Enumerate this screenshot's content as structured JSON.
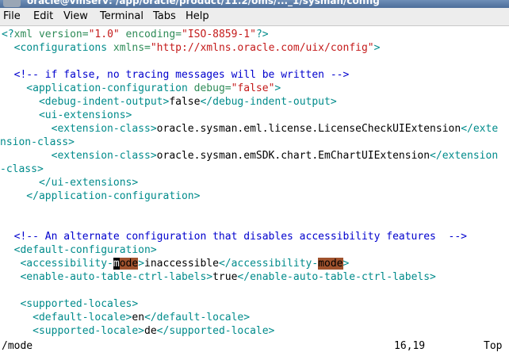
{
  "window": {
    "title": "oracle@vmserv: /app/oracle/product/11.2/oms/..._1/sysman/config"
  },
  "menu": {
    "file": "File",
    "edit": "Edit",
    "view": "View",
    "terminal": "Terminal",
    "tabs": "Tabs",
    "help": "Help"
  },
  "lines": {
    "l1": {
      "p1": "<?",
      "p2": "xml",
      "p3": " version=",
      "p4": "\"1.0\"",
      "p5": " encoding=",
      "p6": "\"ISO-8859-1\"",
      "p7": "?>"
    },
    "l2": {
      "p1": "  <configurations ",
      "p2": "xmlns=",
      "p3": "\"http://xmlns.oracle.com/uix/config\"",
      "p4": ">"
    },
    "l4": {
      "p1": "  <!-- if false, no tracing messages will be written -->"
    },
    "l5": {
      "p1": "    <application-configuration ",
      "p2": "debug=",
      "p3": "\"false\"",
      "p4": ">"
    },
    "l6": {
      "p1": "      <debug-indent-output>",
      "p2": "false",
      "p3": "</debug-indent-output>"
    },
    "l7": {
      "p1": "      <ui-extensions>"
    },
    "l8": {
      "p1": "        <extension-class>",
      "p2": "oracle.sysman.eml.license.LicenseCheckUIExtension",
      "p3": "</exte"
    },
    "l9": {
      "p1": "nsion-class>"
    },
    "l10": {
      "p1": "        <extension-class>",
      "p2": "oracle.sysman.emSDK.chart.EmChartUIExtension",
      "p3": "</extension"
    },
    "l11": {
      "p1": "-class>"
    },
    "l12": {
      "p1": "      </ui-extensions>"
    },
    "l13": {
      "p1": "    </application-configuration>"
    },
    "l16": {
      "p1": "  <!-- An alternate configuration that disables accessibility features  -->"
    },
    "l17": {
      "p1": "  <default-configuration>"
    },
    "l18": {
      "p1": "   <accessibility-",
      "p2": "m",
      "p3": "ode",
      "p4": ">",
      "p5": "inaccessible",
      "p6": "</accessibility-",
      "p7": "mode",
      "p8": ">"
    },
    "l19": {
      "p1": "   <enable-auto-table-ctrl-labels>",
      "p2": "true",
      "p3": "</enable-auto-table-ctrl-labels>"
    },
    "l21": {
      "p1": "   <supported-locales>"
    },
    "l22": {
      "p1": "     <default-locale>",
      "p2": "en",
      "p3": "</default-locale>"
    },
    "l23": {
      "p1": "     <supported-locale>",
      "p2": "de",
      "p3": "</supported-locale>"
    }
  },
  "status": {
    "command": "/mode",
    "position": "16,19",
    "scroll": "Top"
  },
  "colors": {
    "tag": "#008b8b",
    "attribute": "#2e8b57",
    "string": "#c41a1a",
    "comment": "#0000cd",
    "search_highlight": "#a0522d"
  }
}
